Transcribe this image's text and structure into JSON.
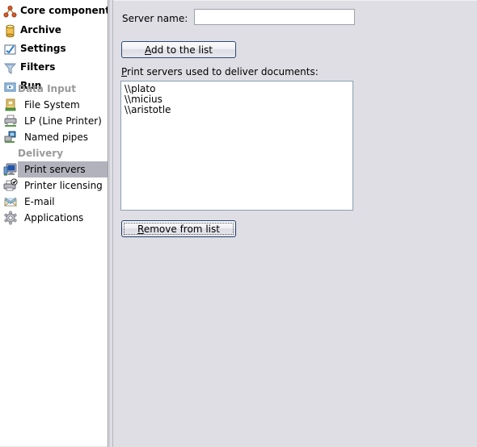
{
  "sidebar": {
    "top_items": [
      {
        "label": "Core components",
        "icon": "network-nodes-icon"
      },
      {
        "label": "Archive",
        "icon": "database-cylinder-icon"
      },
      {
        "label": "Settings",
        "icon": "checkmark-chart-icon"
      },
      {
        "label": "Filters",
        "icon": "funnel-icon"
      },
      {
        "label": "Run",
        "icon": "run-window-icon"
      }
    ],
    "groups": [
      {
        "header": "Data Input",
        "items": [
          {
            "label": "File System",
            "icon": "folder-open-icon",
            "selected": false
          },
          {
            "label": "LP (Line Printer)",
            "icon": "printer-icon",
            "selected": false
          },
          {
            "label": "Named pipes",
            "icon": "pipes-network-icon",
            "selected": false
          }
        ]
      },
      {
        "header": "Delivery",
        "items": [
          {
            "label": "Print servers",
            "icon": "monitor-icon",
            "selected": true
          },
          {
            "label": "Printer licensing",
            "icon": "printer-check-icon",
            "selected": false
          },
          {
            "label": "E-mail",
            "icon": "envelope-icon",
            "selected": false
          },
          {
            "label": "Applications",
            "icon": "gear-icon",
            "selected": false
          }
        ]
      }
    ],
    "selected_item": "Print servers"
  },
  "content": {
    "server_name_label": "Server name:",
    "server_name_value": "",
    "server_name_placeholder": "",
    "add_button": {
      "prefix": "",
      "accel": "A",
      "suffix": "dd to the list"
    },
    "list_label": {
      "accel": "P",
      "suffix": "rint servers used to deliver documents:"
    },
    "listbox_items": [
      "\\\\plato",
      "\\\\micius",
      "\\\\aristotle"
    ],
    "remove_button": {
      "accel": "R",
      "suffix": "emove from list"
    }
  },
  "colors": {
    "window_background": "#dedee4",
    "sidebar_background": "#ffffff",
    "selection_highlight": "#b2b2bd",
    "group_header_text": "#9a9a9a",
    "button_border": "#2b4a74",
    "listbox_border": "#8f9fb2",
    "input_border": "#a0a0a8"
  }
}
